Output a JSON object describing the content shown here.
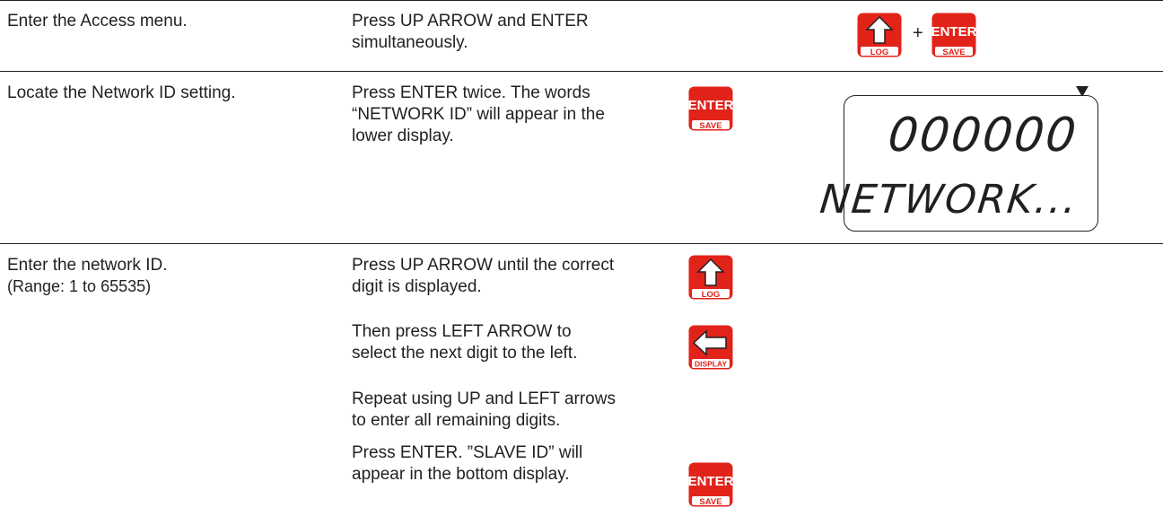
{
  "rows": [
    {
      "step": "Enter the Access menu.",
      "instruction_lines": [
        "Press UP ARROW and ENTER",
        "simultaneously."
      ],
      "keys": [
        {
          "icon": "up-arrow-icon",
          "caption": "LOG"
        },
        {
          "icon": "enter-key-icon",
          "label": "ENTER",
          "caption": "SAVE"
        }
      ],
      "combo_symbol": "+"
    },
    {
      "step": "Locate the Network ID setting.",
      "instruction_lines": [
        "Press ENTER twice. The words",
        "“NETWORK ID” will appear in the",
        "lower display."
      ],
      "keys": [
        {
          "icon": "enter-key-icon",
          "label": "ENTER",
          "caption": "SAVE"
        }
      ],
      "display": {
        "upper": "000000",
        "lower": "NETWORK..."
      }
    },
    {
      "step": "Enter the network ID.",
      "step_note": "(Range: 1 to 65535)",
      "substeps": [
        {
          "lines": [
            "Press UP ARROW until the correct",
            "digit is displayed."
          ],
          "key": {
            "icon": "up-arrow-icon",
            "caption": "LOG"
          }
        },
        {
          "lines": [
            "Then press LEFT ARROW to",
            "select the next digit to the left."
          ],
          "key": {
            "icon": "left-arrow-icon",
            "caption": "DISPLAY"
          }
        },
        {
          "lines": [
            "Repeat using UP and LEFT arrows",
            "to enter all remaining digits."
          ]
        },
        {
          "lines": [
            "Press ENTER. ”SLAVE ID” will",
            "appear in the bottom display."
          ],
          "key": {
            "icon": "enter-key-icon",
            "label": "ENTER",
            "caption": "SAVE"
          }
        }
      ]
    }
  ],
  "colors": {
    "key_red": "#e2231a",
    "text": "#231f20"
  }
}
